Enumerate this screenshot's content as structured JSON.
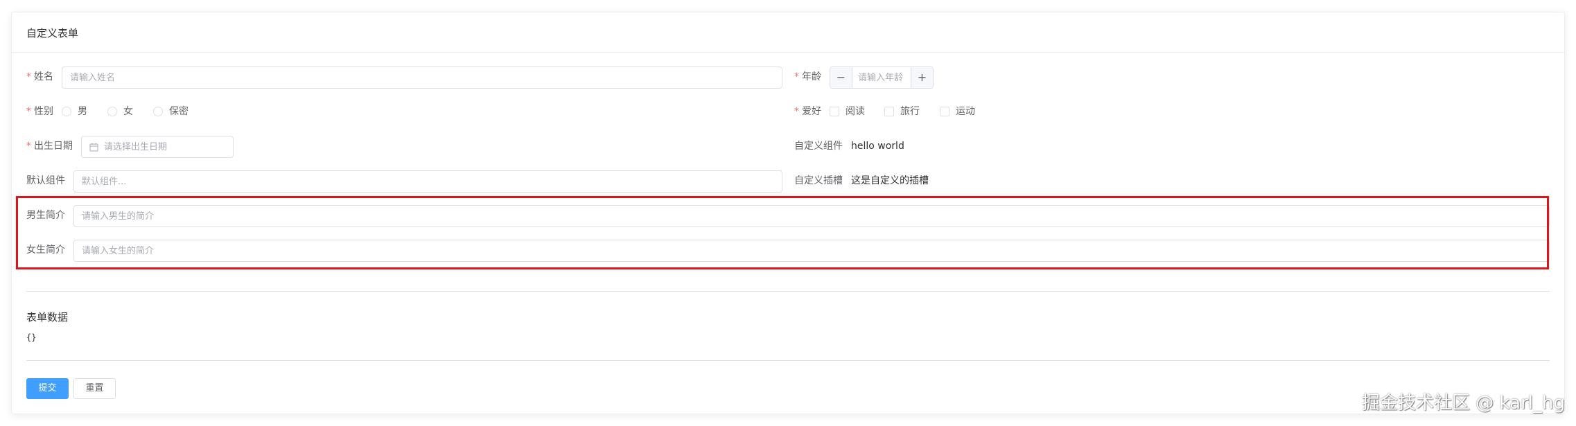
{
  "card": {
    "title": "自定义表单"
  },
  "form": {
    "name": {
      "required_mark": "*",
      "label": "姓名",
      "placeholder": "请输入姓名"
    },
    "age": {
      "required_mark": "*",
      "label": "年龄",
      "placeholder": "请输入年龄",
      "decrease": "−",
      "increase": "+"
    },
    "gender": {
      "required_mark": "*",
      "label": "性别",
      "options": [
        "男",
        "女",
        "保密"
      ]
    },
    "hobbies": {
      "required_mark": "*",
      "label": "爱好",
      "options": [
        "阅读",
        "旅行",
        "运动"
      ]
    },
    "birthday": {
      "required_mark": "*",
      "label": "出生日期",
      "placeholder": "请选择出生日期"
    },
    "custom_component": {
      "label": "自定义组件",
      "value": "hello world"
    },
    "default_component": {
      "label": "默认组件",
      "placeholder": "默认组件..."
    },
    "custom_slot": {
      "label": "自定义插槽",
      "value": "这是自定义的插槽"
    },
    "male_intro": {
      "label": "男生简介",
      "placeholder": "请输入男生的简介"
    },
    "female_intro": {
      "label": "女生简介",
      "placeholder": "请输入女生的简介"
    }
  },
  "form_data": {
    "title": "表单数据",
    "json": "{}"
  },
  "actions": {
    "submit_label": "提交",
    "reset_label": "重置"
  },
  "watermark": "掘金技术社区 @ karl_hg",
  "colors": {
    "primary": "#409eff",
    "required": "#f56c6c",
    "highlight_box": "#e0131b"
  }
}
